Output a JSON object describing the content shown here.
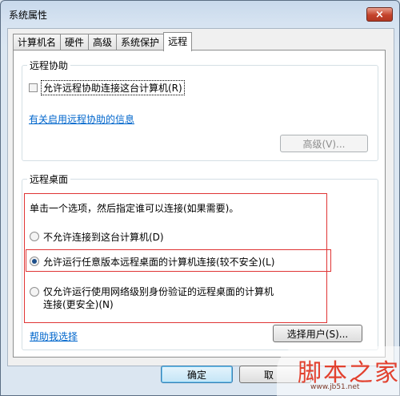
{
  "window": {
    "title": "系统属性",
    "close_symbol": "×"
  },
  "tabs": [
    {
      "label": "计算机名"
    },
    {
      "label": "硬件"
    },
    {
      "label": "高级"
    },
    {
      "label": "系统保护"
    },
    {
      "label": "远程",
      "active": true
    }
  ],
  "remote_assistance": {
    "group_title": "远程协助",
    "allow_checkbox_label": "允许远程协助连接这台计算机(R)",
    "allow_checked": false,
    "info_link": "有关启用远程协助的信息",
    "advanced_button": "高级(V)..."
  },
  "remote_desktop": {
    "group_title": "远程桌面",
    "instruction": "单击一个选项，然后指定谁可以连接(如果需要)。",
    "options": [
      {
        "label": "不允许连接到这台计算机(D)",
        "checked": false
      },
      {
        "label": "允许运行任意版本远程桌面的计算机连接(较不安全)(L)",
        "checked": true
      },
      {
        "label": "仅允许运行使用网络级别身份验证的远程桌面的计算机连接(更安全)(N)",
        "label_line1": "仅允许运行使用网络级别身份验证的远程桌面的计算机",
        "label_line2": "连接(更安全)(N)",
        "checked": false
      }
    ],
    "help_link": "帮助我选择",
    "select_users_button": "选择用户(S)..."
  },
  "footer": {
    "ok_button": "确定",
    "cancel_button": "取"
  },
  "watermark": {
    "main": "脚本之家",
    "sub": "www.jb51.net"
  },
  "colors": {
    "highlight_box": "#e03535",
    "link": "#0066cc",
    "close_button": "#c4432b"
  }
}
